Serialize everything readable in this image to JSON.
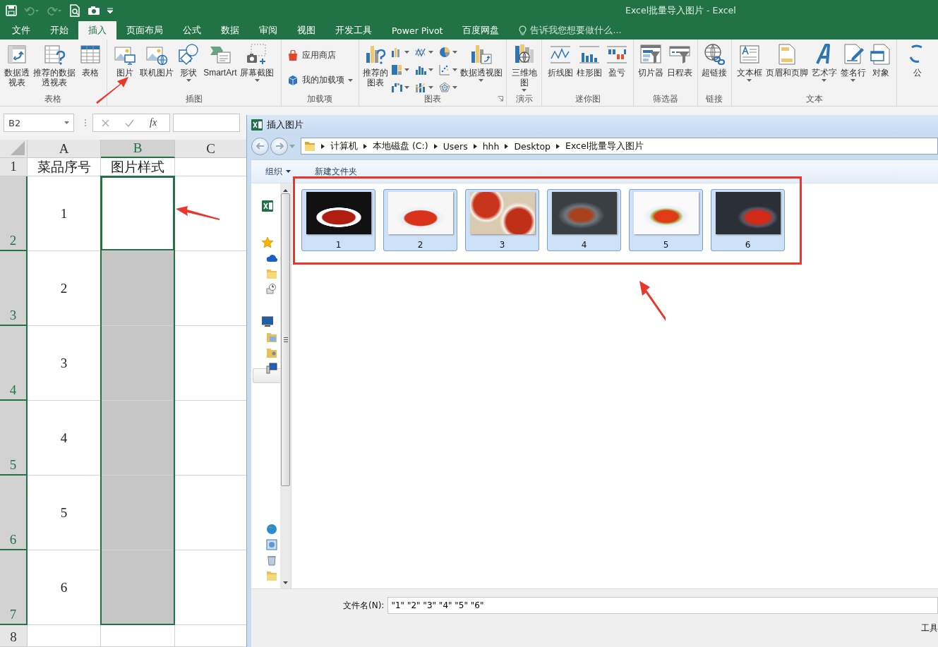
{
  "window": {
    "title": "Excel批量导入图片 - Excel"
  },
  "tabs": [
    {
      "label": "文件",
      "selected": false
    },
    {
      "label": "开始",
      "selected": false
    },
    {
      "label": "插入",
      "selected": true
    },
    {
      "label": "页面布局",
      "selected": false
    },
    {
      "label": "公式",
      "selected": false
    },
    {
      "label": "数据",
      "selected": false
    },
    {
      "label": "审阅",
      "selected": false
    },
    {
      "label": "视图",
      "selected": false
    },
    {
      "label": "开发工具",
      "selected": false
    },
    {
      "label": "Power Pivot",
      "selected": false
    },
    {
      "label": "百度网盘",
      "selected": false
    }
  ],
  "tell_me": {
    "text": "告诉我您想要做什么..."
  },
  "ribbon": {
    "groups": [
      {
        "label": "表格",
        "items": [
          {
            "kind": "large",
            "label": "数据透视表"
          },
          {
            "kind": "large",
            "label": "推荐的数据透视表"
          },
          {
            "kind": "large",
            "label": "表格"
          }
        ]
      },
      {
        "label": "插图",
        "items": [
          {
            "kind": "large",
            "label": "图片"
          },
          {
            "kind": "large",
            "label": "联机图片"
          },
          {
            "kind": "large",
            "label": "形状",
            "dropdown": true
          },
          {
            "kind": "large",
            "label": "SmartArt"
          },
          {
            "kind": "large",
            "label": "屏幕截图",
            "dropdown": true
          }
        ]
      },
      {
        "label": "加载项",
        "items": [
          {
            "kind": "small",
            "label": "应用商店"
          },
          {
            "kind": "small",
            "label": "我的加载项",
            "dropdown": true
          }
        ]
      },
      {
        "label": "图表",
        "launcher": true,
        "items": [
          {
            "kind": "large",
            "label": "推荐的图表"
          },
          {
            "kind": "gallery"
          },
          {
            "kind": "large",
            "label": "数据透视图",
            "dropdown": true
          }
        ]
      },
      {
        "label": "演示",
        "items": [
          {
            "kind": "large",
            "label": "三维地图",
            "dropdown": true
          }
        ]
      },
      {
        "label": "迷你图",
        "items": [
          {
            "kind": "large",
            "label": "折线图"
          },
          {
            "kind": "large",
            "label": "柱形图"
          },
          {
            "kind": "large",
            "label": "盈亏"
          }
        ]
      },
      {
        "label": "筛选器",
        "items": [
          {
            "kind": "large",
            "label": "切片器"
          },
          {
            "kind": "large",
            "label": "日程表"
          }
        ]
      },
      {
        "label": "链接",
        "items": [
          {
            "kind": "large",
            "label": "超链接"
          }
        ]
      },
      {
        "label": "文本",
        "items": [
          {
            "kind": "large",
            "label": "文本框",
            "dropdown": true
          },
          {
            "kind": "large",
            "label": "页眉和页脚"
          },
          {
            "kind": "large",
            "label": "艺术字",
            "dropdown": true
          },
          {
            "kind": "large",
            "label": "签名行",
            "dropdown": true
          },
          {
            "kind": "large",
            "label": "对象"
          }
        ]
      },
      {
        "items": [
          {
            "kind": "large",
            "label": "公"
          }
        ]
      }
    ]
  },
  "formula_bar": {
    "name_box": "B2",
    "function_label": "fx"
  },
  "sheet": {
    "columns": [
      {
        "label": "A",
        "selected": false
      },
      {
        "label": "B",
        "selected": true
      },
      {
        "label": "C",
        "selected": false
      }
    ],
    "rows": [
      {
        "header": "1",
        "a": "菜品序号",
        "b": "图片样式",
        "selected": false,
        "active": false
      },
      {
        "header": "2",
        "a": "1",
        "selected": true,
        "active": true
      },
      {
        "header": "3",
        "a": "2",
        "selected": true,
        "active": false
      },
      {
        "header": "4",
        "a": "3",
        "selected": true,
        "active": false
      },
      {
        "header": "5",
        "a": "4",
        "selected": true,
        "active": false
      },
      {
        "header": "6",
        "a": "5",
        "selected": true,
        "active": false
      },
      {
        "header": "7",
        "a": "6",
        "selected": true,
        "active": false
      },
      {
        "header": "8",
        "selected": false,
        "active": false
      }
    ]
  },
  "dialog": {
    "title": "插入图片",
    "path": [
      "计算机",
      "本地磁盘 (C:)",
      "Users",
      "hhh",
      "Desktop",
      "Excel批量导入图片"
    ],
    "toolbar": [
      "组织",
      "新建文件夹"
    ],
    "files": [
      {
        "name": "1",
        "selected": true
      },
      {
        "name": "2",
        "selected": true
      },
      {
        "name": "3",
        "selected": true
      },
      {
        "name": "4",
        "selected": true
      },
      {
        "name": "5",
        "selected": true
      },
      {
        "name": "6",
        "selected": true
      }
    ],
    "file_name_label": "文件名(N):",
    "file_name": "\"1\" \"2\" \"3\" \"4\" \"5\" \"6\"",
    "tools": "工具"
  }
}
